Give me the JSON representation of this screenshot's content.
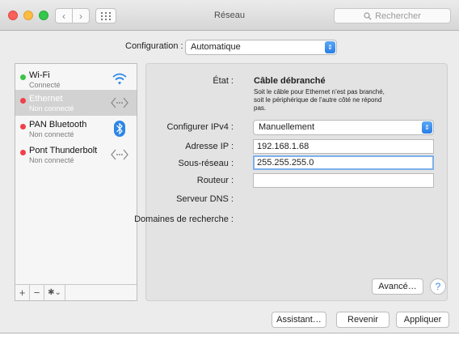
{
  "window": {
    "title": "Réseau"
  },
  "toolbar": {
    "search_placeholder": "Rechercher",
    "back_glyph": "‹",
    "forward_glyph": "›"
  },
  "configuration": {
    "label": "Configuration :",
    "value": "Automatique"
  },
  "services": [
    {
      "name": "Wi-Fi",
      "status": "Connecté",
      "status_color": "#3cc34a",
      "icon": "wifi-icon",
      "selected": false
    },
    {
      "name": "Ethernet",
      "status": "Non connecté",
      "status_color": "#f0404a",
      "icon": "ethernet-icon",
      "selected": true
    },
    {
      "name": "PAN Bluetooth",
      "status": "Non connecté",
      "status_color": "#f0404a",
      "icon": "bluetooth-icon",
      "selected": false
    },
    {
      "name": "Pont Thunderbolt",
      "status": "Non connecté",
      "status_color": "#f0404a",
      "icon": "ethernet-icon",
      "selected": false
    }
  ],
  "sidebar_controls": {
    "add": "+",
    "remove": "−",
    "gear": "✱⌄"
  },
  "detail": {
    "state_label": "État :",
    "state_value": "Câble débranché",
    "state_note": "Soit le câble pour Ethernet n’est pas branché, soit le périphérique de l’autre côté ne répond pas.",
    "ipv4_label": "Configurer IPv4 :",
    "ipv4_value": "Manuellement",
    "ip_label": "Adresse IP :",
    "ip_value": "192.168.1.68",
    "subnet_label": "Sous-réseau :",
    "subnet_value": "255.255.255.0",
    "router_label": "Routeur :",
    "router_value": "",
    "dns_label": "Serveur DNS :",
    "search_domains_label": "Domaines de recherche :",
    "advanced_label": "Avancé…",
    "help_label": "?"
  },
  "footer": {
    "assistant_label": "Assistant…",
    "revert_label": "Revenir",
    "apply_label": "Appliquer"
  },
  "colors": {
    "accent": "#2a7ee6",
    "selection": "#d2d2d2"
  }
}
